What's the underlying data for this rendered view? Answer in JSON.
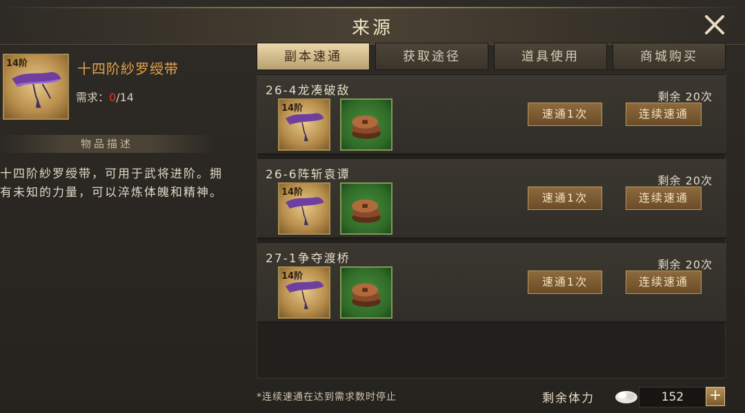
{
  "window": {
    "title": "来源"
  },
  "item": {
    "tier": "14阶",
    "name": "十四阶紗罗绶带",
    "requirement_label": "需求：",
    "requirement_current": "0",
    "requirement_total": "/14",
    "description_header": "物品描述",
    "description": "十四阶紗罗绶带，可用于武将进阶。拥有未知的力量，可以淬炼体魄和精神。"
  },
  "tabs": [
    {
      "label": "副本速通",
      "active": true
    },
    {
      "label": "获取途径",
      "active": false
    },
    {
      "label": "道具使用",
      "active": false
    },
    {
      "label": "商城购买",
      "active": false
    }
  ],
  "stages": [
    {
      "title": "26-4龙凑破敌",
      "remaining": "剩余 20次",
      "reward_tier": "14阶",
      "btn_once": "速通1次",
      "btn_continuous": "连续速通"
    },
    {
      "title": "26-6阵斩袁谭",
      "remaining": "剩余 20次",
      "reward_tier": "14阶",
      "btn_once": "速通1次",
      "btn_continuous": "连续速通"
    },
    {
      "title": "27-1争夺渡桥",
      "remaining": "剩余 20次",
      "reward_tier": "14阶",
      "btn_once": "速通1次",
      "btn_continuous": "连续速通"
    }
  ],
  "footer": {
    "note": "*连续速通在达到需求数时停止",
    "stamina_label": "剩余体力",
    "stamina_value": "152",
    "plus": "+"
  },
  "colors": {
    "accent_orange": "#e6a04a",
    "requirement_red": "#d83a2a",
    "tab_active": "#e9d7ab"
  },
  "icons": [
    "close-icon",
    "sash-icon",
    "coins-icon",
    "stamina-icon",
    "plus-icon"
  ]
}
